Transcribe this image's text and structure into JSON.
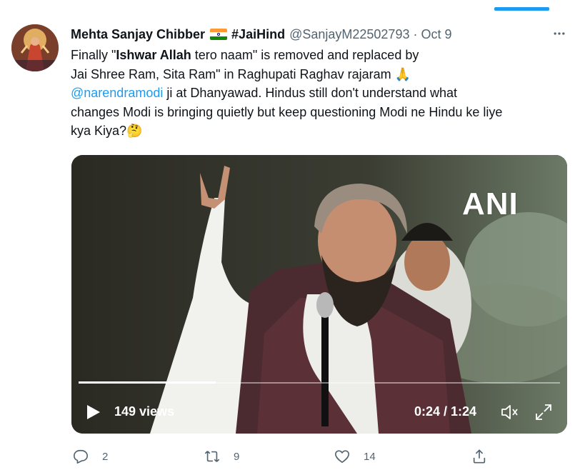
{
  "tweet": {
    "author_name": "Mehta Sanjay Chibber",
    "flag_icon": "india-flag-emoji",
    "hashtag": "#JaiHind",
    "handle": "@SanjayM22502793",
    "separator": "·",
    "date": "Oct 9",
    "more_icon": "more-dots-icon",
    "text": {
      "line1_pre": "Finally \"",
      "line1_bold": "Ishwar Allah",
      "line1_post": " tero naam\" is removed and replaced by",
      "line2": "Jai Shree Ram, Sita Ram\" in Raghupati Raghav rajaram 🙏",
      "mention": "@narendramodi",
      "line3_post": " ji at Dhanyawad. Hindus still don't understand what",
      "line4": "changes Modi is bringing quietly but keep questioning Modi ne Hindu ke liye",
      "line5": "kya Kiya?🤔"
    }
  },
  "video": {
    "watermark": "ANI",
    "views": "149 views",
    "time": "0:24 / 1:24",
    "progress": 0.285,
    "icons": [
      "play-icon",
      "volume-icon",
      "fullscreen-icon"
    ]
  },
  "actions": {
    "reply_count": "2",
    "retweet_count": "9",
    "like_count": "14",
    "icons": [
      "reply-icon",
      "retweet-icon",
      "like-icon",
      "share-icon"
    ]
  },
  "colors": {
    "accent": "#1d9bf0",
    "muted": "#536471",
    "text": "#0f1419"
  }
}
